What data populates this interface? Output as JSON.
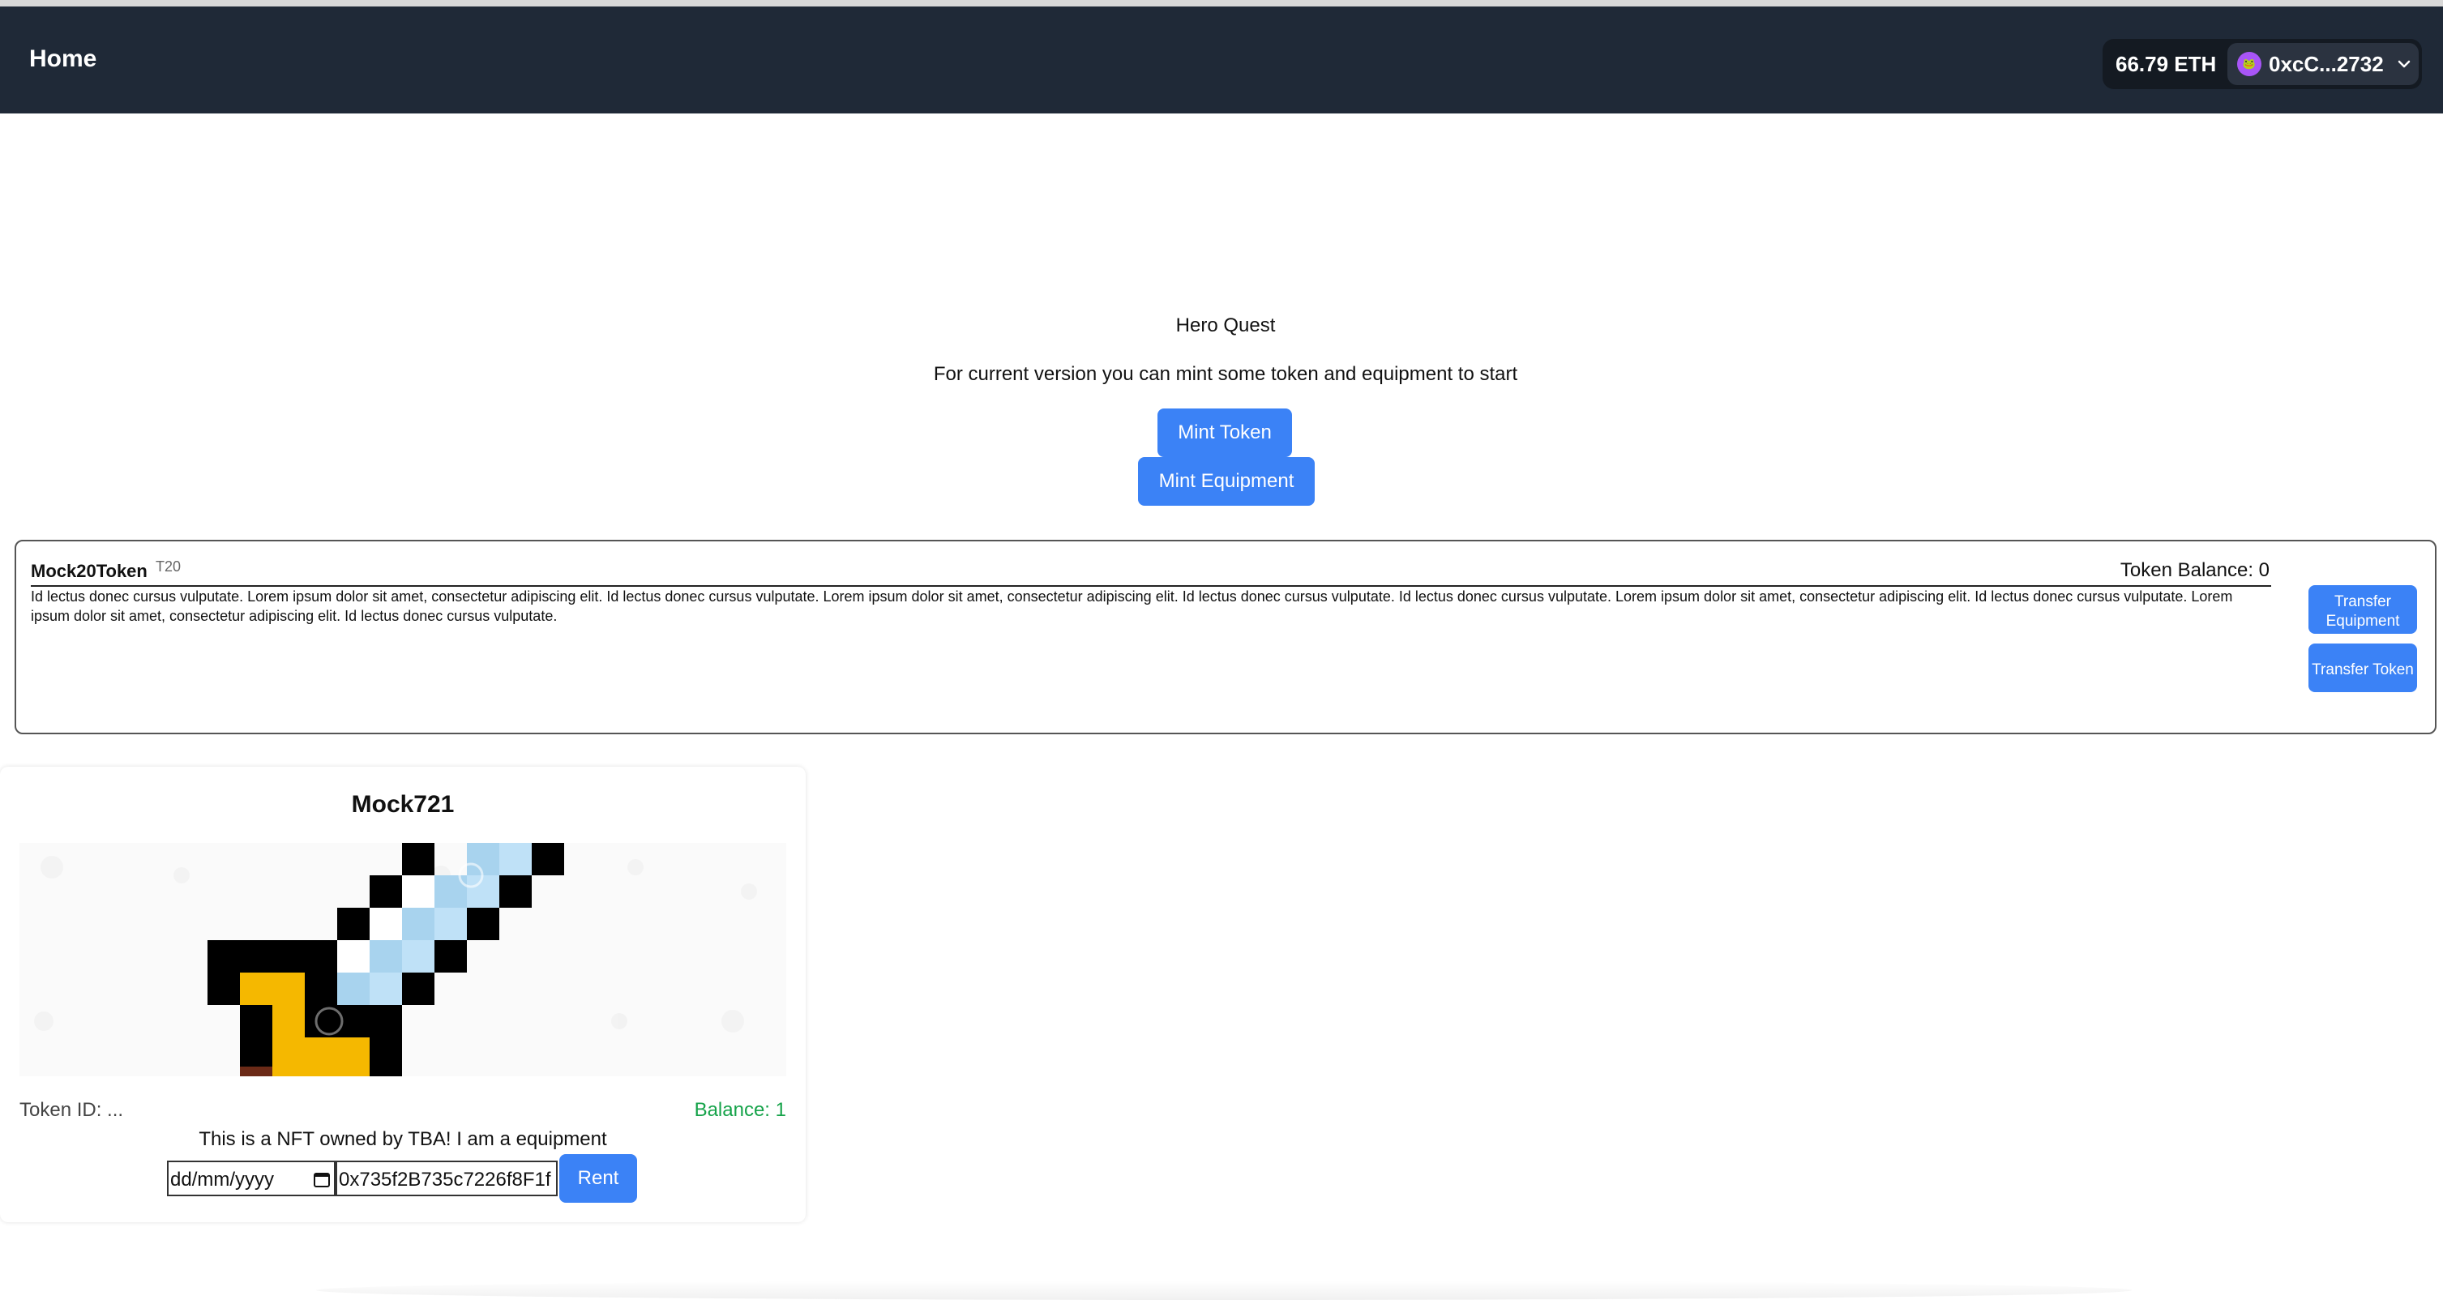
{
  "nav": {
    "home_label": "Home",
    "eth_balance": "66.79 ETH",
    "account_address": "0xcC...2732",
    "avatar_glyph": "🐸"
  },
  "hero": {
    "title": "Hero Quest",
    "subtitle": "For current version you can mint some token and equipment to start",
    "mint_token_label": "Mint Token",
    "mint_equipment_label": "Mint Equipment"
  },
  "token_card": {
    "name": "Mock20Token",
    "symbol": "T20",
    "balance_text": "Token Balance: 0",
    "description": "Id lectus donec cursus vulputate. Lorem ipsum dolor sit amet, consectetur adipiscing elit. Id lectus donec cursus vulputate. Lorem ipsum dolor sit amet, consectetur adipiscing elit. Id lectus donec cursus vulputate. Id lectus donec cursus vulputate. Lorem ipsum dolor sit amet, consectetur adipiscing elit. Id lectus donec cursus vulputate. Lorem ipsum dolor sit amet, consectetur adipiscing elit. Id lectus donec cursus vulputate.",
    "transfer_equipment_label": "Transfer Equipment",
    "transfer_token_label": "Transfer Token"
  },
  "nft_card": {
    "title": "Mock721",
    "token_id_text": "Token ID: ...",
    "balance_text": "Balance: 1",
    "description": "This is a NFT owned by TBA! I am a equipment",
    "date_placeholder": "dd/mm/yyyy",
    "address_value": "0x735f2B735c7226f8F1f",
    "rent_label": "Rent"
  },
  "colors": {
    "navbar": "#1f2937",
    "button": "#3b82f6",
    "balance_green": "#16a34a"
  }
}
